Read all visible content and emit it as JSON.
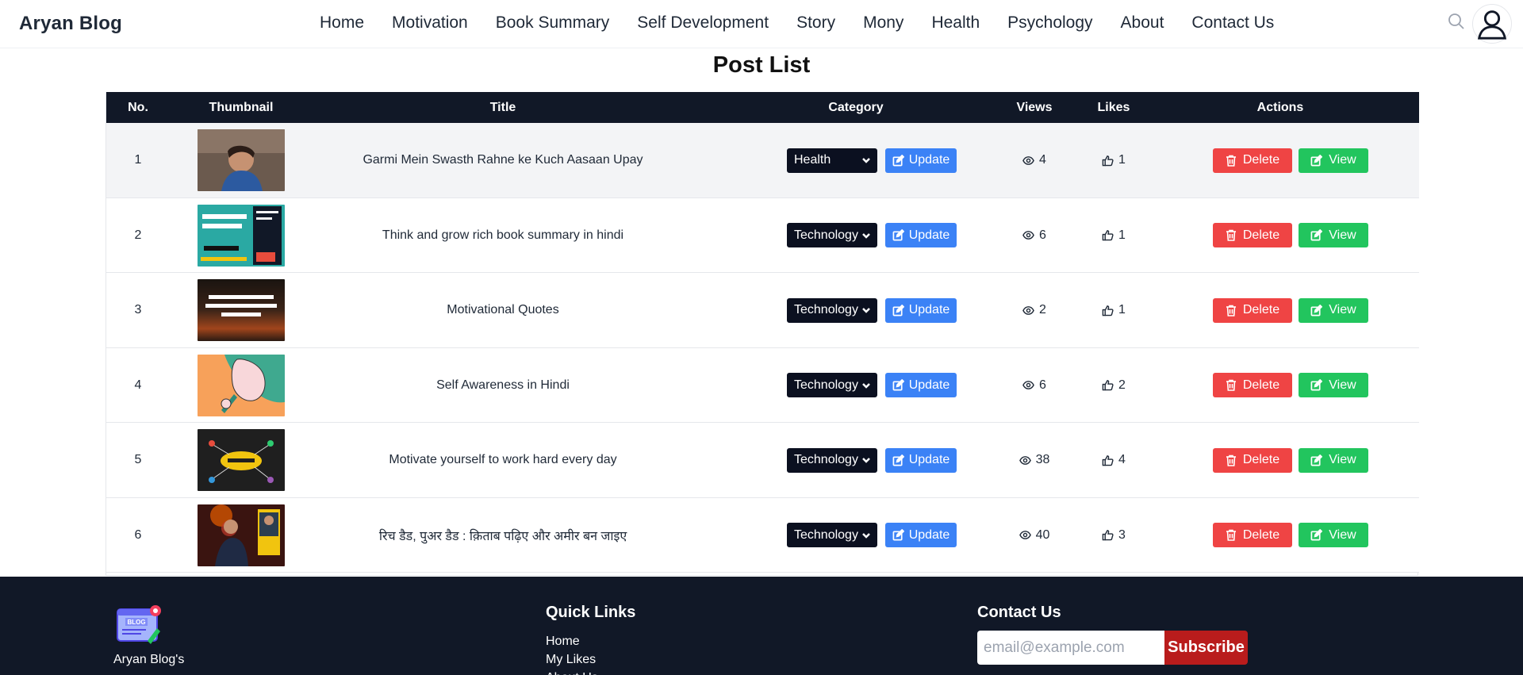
{
  "header": {
    "brand": "Aryan Blog",
    "nav": [
      "Home",
      "Motivation",
      "Book Summary",
      "Self Development",
      "Story",
      "Mony",
      "Health",
      "Psychology",
      "About",
      "Contact Us"
    ]
  },
  "page_title": "Post List",
  "table": {
    "headers": [
      "No.",
      "Thumbnail",
      "Title",
      "Category",
      "Views",
      "Likes",
      "Actions"
    ],
    "update_label": "Update",
    "delete_label": "Delete",
    "view_label": "View",
    "rows": [
      {
        "no": "1",
        "title": "Garmi Mein Swasth Rahne ke Kuch Aasaan Upay",
        "category": "Health",
        "views": "4",
        "likes": "1"
      },
      {
        "no": "2",
        "title": "Think and grow rich book summary in hindi",
        "category": "Technology",
        "views": "6",
        "likes": "1"
      },
      {
        "no": "3",
        "title": "Motivational Quotes",
        "category": "Technology",
        "views": "2",
        "likes": "1"
      },
      {
        "no": "4",
        "title": "Self Awareness in Hindi",
        "category": "Technology",
        "views": "6",
        "likes": "2"
      },
      {
        "no": "5",
        "title": "Motivate yourself to work hard every day",
        "category": "Technology",
        "views": "38",
        "likes": "4"
      },
      {
        "no": "6",
        "title": "रिच डैड, पुअर डैड : क़िताब पढ़िए और अमीर बन जाइए",
        "category": "Technology",
        "views": "40",
        "likes": "3"
      }
    ]
  },
  "footer": {
    "brand": "Aryan Blog's",
    "logo_text": "BLOG",
    "quick_links_title": "Quick Links",
    "quick_links": [
      "Home",
      "My Likes",
      "About Us"
    ],
    "contact_title": "Contact Us",
    "email_placeholder": "email@example.com",
    "subscribe_label": "Subscribe"
  },
  "colors": {
    "header_bg": "#111827",
    "update": "#3b82f6",
    "delete": "#ef4444",
    "view": "#22c55e",
    "subscribe": "#b91c1c"
  }
}
